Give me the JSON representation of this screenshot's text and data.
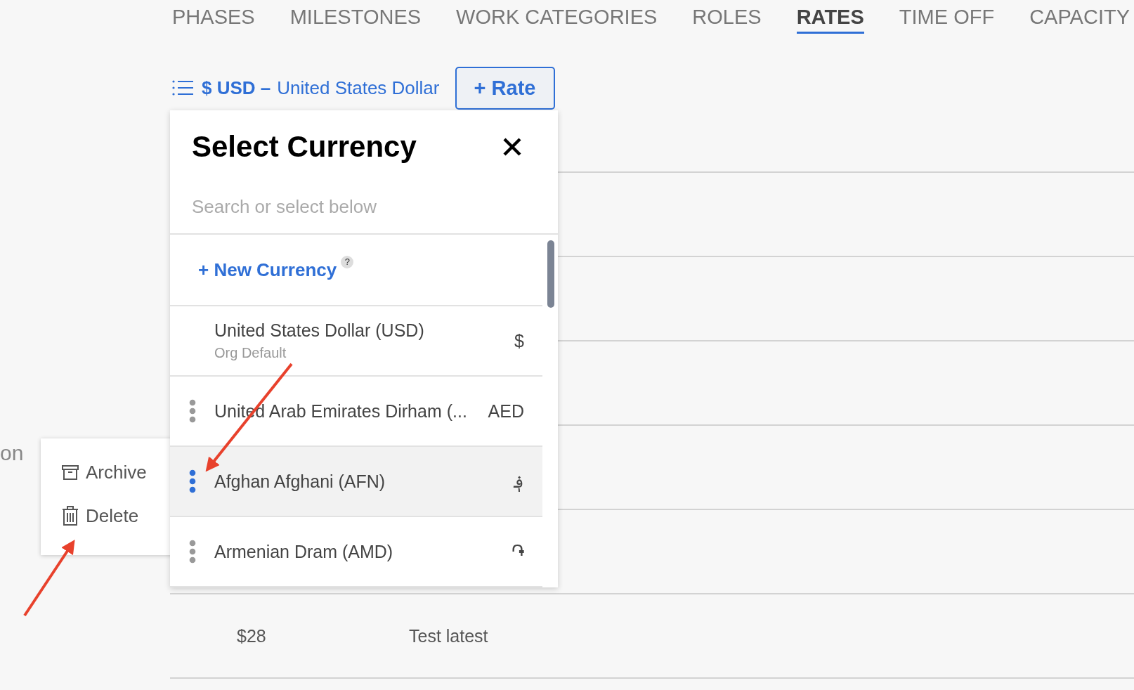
{
  "tabs": [
    {
      "label": "PHASES",
      "selected": false
    },
    {
      "label": "MILESTONES",
      "selected": false
    },
    {
      "label": "WORK CATEGORIES",
      "selected": false
    },
    {
      "label": "ROLES",
      "selected": false
    },
    {
      "label": "RATES",
      "selected": true
    },
    {
      "label": "TIME OFF",
      "selected": false
    },
    {
      "label": "CAPACITY",
      "selected": false
    }
  ],
  "currency": {
    "code": "$ USD –",
    "name": "United States Dollar"
  },
  "add_rate_button": "+ Rate",
  "side_text": "on",
  "rows": [
    {
      "rate": "",
      "description": ""
    },
    {
      "rate": "",
      "description": ""
    },
    {
      "rate": "",
      "description": ""
    },
    {
      "rate": "",
      "description": ""
    },
    {
      "rate": "",
      "description": ""
    },
    {
      "rate": "$28",
      "description": "Test latest"
    }
  ],
  "currency_popup": {
    "title": "Select Currency",
    "search": {
      "placeholder": "Search or select below"
    },
    "new_currency": "+ New Currency",
    "help": "?",
    "items": [
      {
        "kind": "default",
        "name": "United States Dollar (USD)",
        "subtitle": "Org Default",
        "symbol": "$",
        "selected": false
      },
      {
        "kind": "custom",
        "name": "United Arab Emirates Dirham (...",
        "symbol": "AED",
        "selected": false
      },
      {
        "kind": "custom",
        "name": "Afghan Afghani (AFN)",
        "symbol": "؋",
        "selected": true
      },
      {
        "kind": "custom",
        "name": "Armenian Dram (AMD)",
        "symbol": "֏",
        "selected": false
      }
    ]
  },
  "context_menu": [
    {
      "kind": "archive",
      "label": "Archive"
    },
    {
      "kind": "delete",
      "label": "Delete"
    }
  ]
}
